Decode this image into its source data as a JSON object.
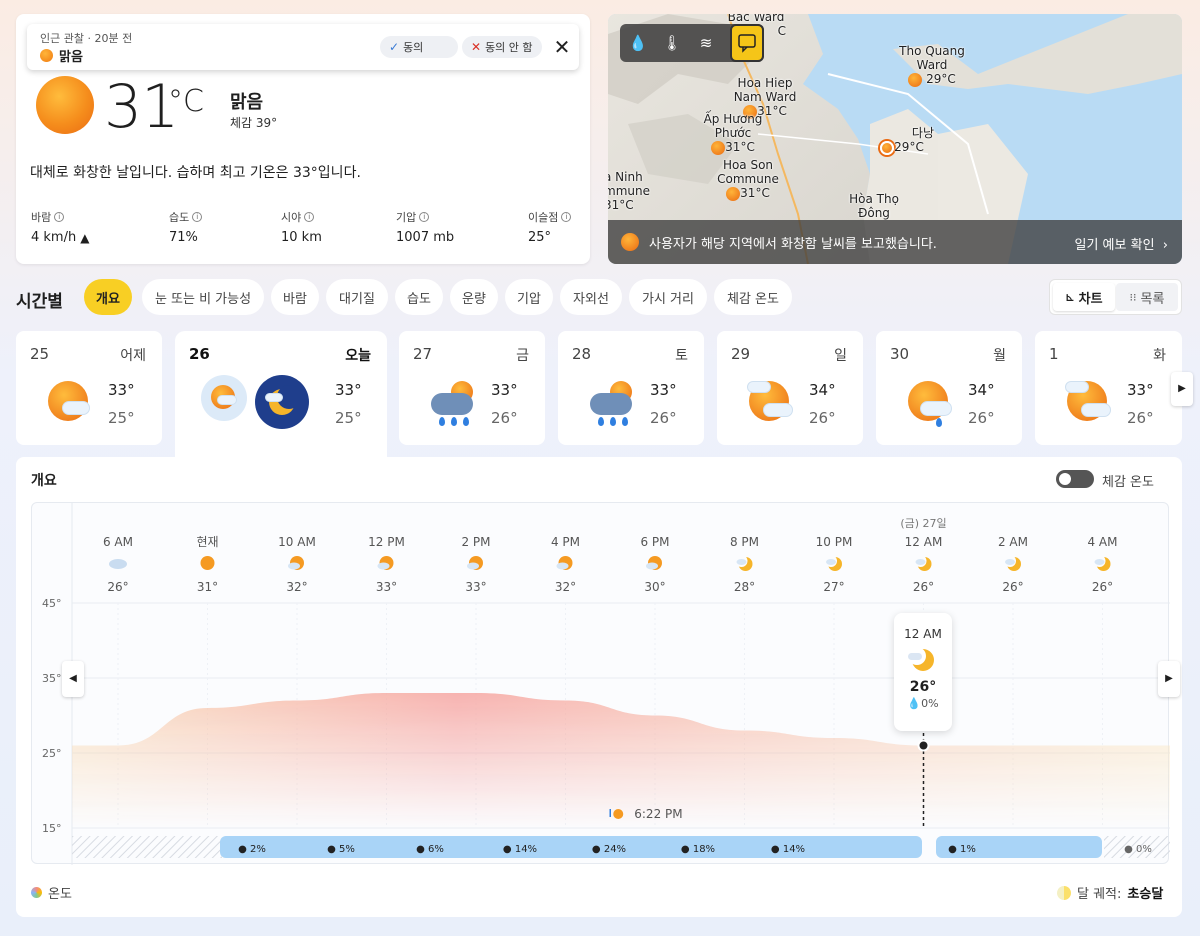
{
  "observation": {
    "caption": "인근 관찰 · 20분 전",
    "condition": "맑음",
    "agree_label": "동의",
    "disagree_label": "동의 안 함"
  },
  "current": {
    "temp": "31",
    "unit": "°C",
    "condition": "맑음",
    "feels_like": "체감   39°",
    "summary": "대체로 화창한 날입니다. 습하며 최고 기온은 33°입니다.",
    "stats": [
      {
        "label": "바람",
        "value": "4 km/h"
      },
      {
        "label": "습도",
        "value": "71%"
      },
      {
        "label": "시야",
        "value": "10 km"
      },
      {
        "label": "기압",
        "value": "1007 mb"
      },
      {
        "label": "이슬점",
        "value": "25°"
      }
    ]
  },
  "map": {
    "labels": [
      {
        "name": "Bac Ward",
        "temp": "C"
      },
      {
        "name": "Tho Quang Ward",
        "temp": "29°C"
      },
      {
        "name": "Hoa Hiep Nam Ward",
        "temp": "31°C"
      },
      {
        "name": "Ấp Hương Phước",
        "temp": "31°C"
      },
      {
        "name": "다낭",
        "temp": "29°C"
      },
      {
        "name": "Hoa Son Commune",
        "temp": "31°C"
      },
      {
        "name": "a Ninh mmune",
        "temp": "31°C"
      },
      {
        "name": "Hòa Thọ Đông",
        "temp": ""
      }
    ],
    "banner_text": "사용자가 해당 지역에서 화창함 날씨를 보고했습니다.",
    "banner_link": "일기 예보 확인"
  },
  "hourly": {
    "title": "시간별",
    "tabs": [
      "개요",
      "눈 또는 비 가능성",
      "바람",
      "대기질",
      "습도",
      "운량",
      "기압",
      "자외선",
      "가시 거리",
      "체감 온도"
    ],
    "view_chart": "차트",
    "view_list": "목록"
  },
  "days": [
    {
      "num": "25",
      "name": "어제",
      "hi": "33°",
      "lo": "25°",
      "icon": "partly-cloudy-icon"
    },
    {
      "num": "26",
      "name": "오늘",
      "hi": "33°",
      "lo": "25°",
      "icon": "partly-cloudy-icon"
    },
    {
      "num": "27",
      "name": "금",
      "hi": "33°",
      "lo": "26°",
      "icon": "rain-icon"
    },
    {
      "num": "28",
      "name": "토",
      "hi": "33°",
      "lo": "26°",
      "icon": "rain-icon"
    },
    {
      "num": "29",
      "name": "일",
      "hi": "34°",
      "lo": "26°",
      "icon": "partly-cloudy-icon"
    },
    {
      "num": "30",
      "name": "월",
      "hi": "34°",
      "lo": "26°",
      "icon": "light-rain-icon"
    },
    {
      "num": "1",
      "name": "화",
      "hi": "33°",
      "lo": "26°",
      "icon": "partly-cloudy-icon"
    }
  ],
  "chart_panel": {
    "title": "개요",
    "feels_toggle_label": "체감 온도",
    "legend_temp": "온도",
    "moon_label": "달 궤적:",
    "moon_phase": "초승달",
    "next_day_label": "(금) 27일",
    "sunset_label": "6:22 PM",
    "tooltip": {
      "time": "12 AM",
      "temp": "26°",
      "precip": "0%"
    }
  },
  "chart_data": {
    "type": "area",
    "x": [
      "6 AM",
      "현재",
      "10 AM",
      "12 PM",
      "2 PM",
      "4 PM",
      "6 PM",
      "8 PM",
      "10 PM",
      "12 AM",
      "2 AM",
      "4 AM"
    ],
    "icons": [
      "cloudy-icon",
      "sun-icon",
      "partly-sunny-icon",
      "partly-sunny-icon",
      "partly-sunny-icon",
      "partly-sunny-icon",
      "partly-sunny-icon",
      "night-partly-cloudy-icon",
      "night-partly-cloudy-icon",
      "night-partly-cloudy-icon",
      "night-partly-cloudy-icon",
      "night-partly-cloudy-icon"
    ],
    "temp_labels": [
      "26°",
      "31°",
      "32°",
      "33°",
      "33°",
      "32°",
      "30°",
      "28°",
      "27°",
      "26°",
      "26°",
      "26°"
    ],
    "series": [
      {
        "values": [
          26,
          31,
          32,
          33,
          33,
          32,
          30,
          28,
          27,
          26,
          26,
          26
        ]
      }
    ],
    "yticks": [
      "45°",
      "35°",
      "25°",
      "15°"
    ],
    "ylim": [
      15,
      45
    ],
    "precip": [
      "2%",
      "5%",
      "6%",
      "14%",
      "24%",
      "18%",
      "14%",
      "1%",
      "0%"
    ],
    "grid": true
  }
}
